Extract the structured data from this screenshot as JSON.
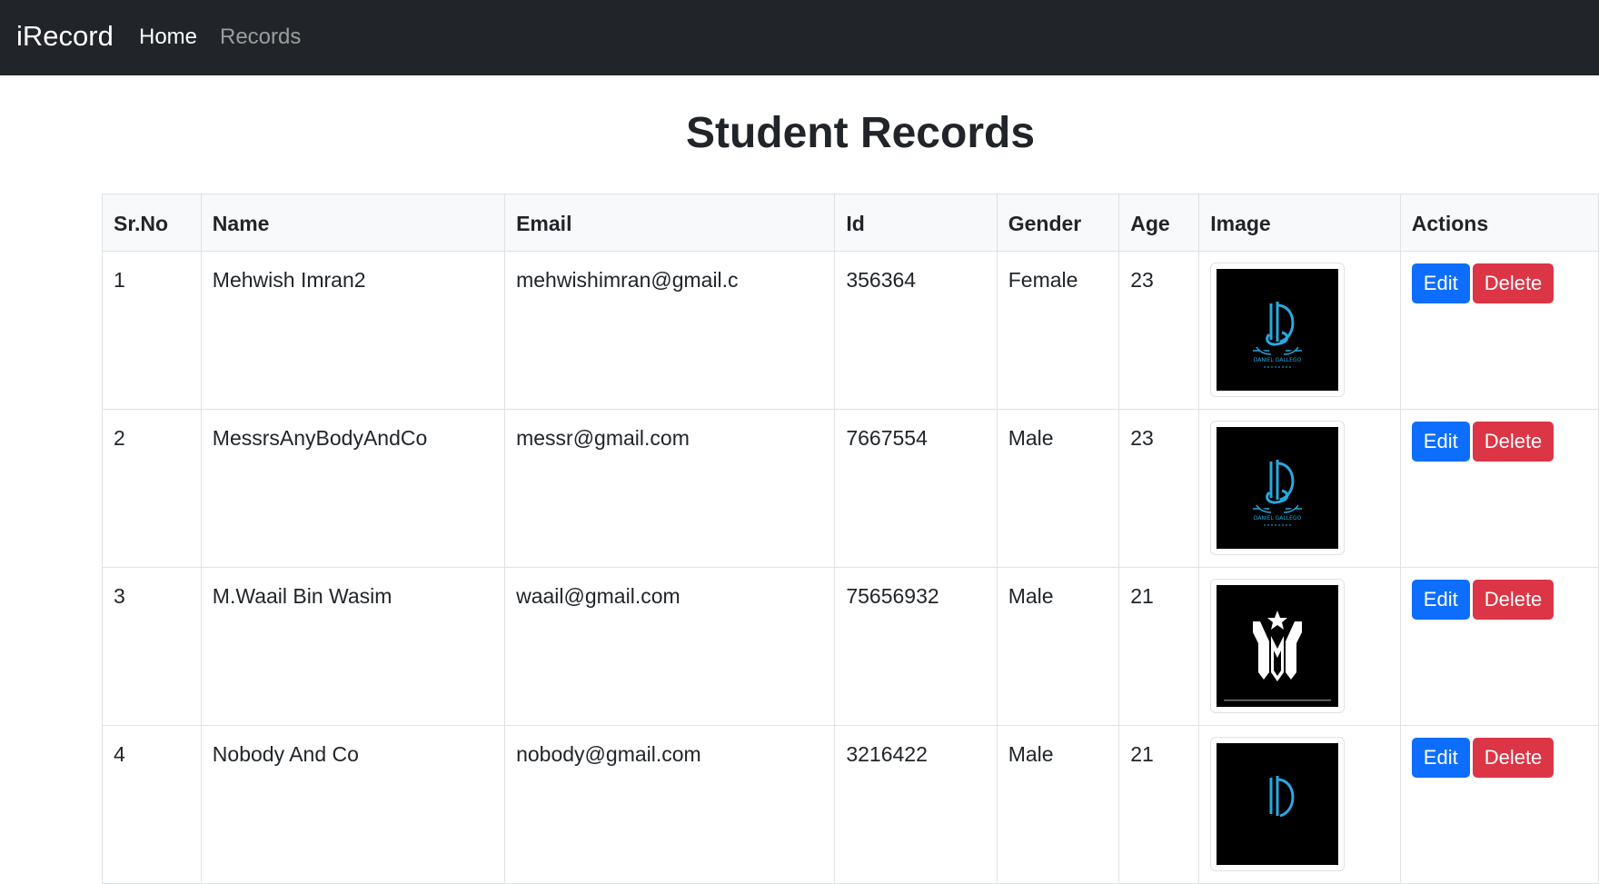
{
  "navbar": {
    "brand": "iRecord",
    "links": [
      {
        "label": "Home",
        "active": true
      },
      {
        "label": "Records",
        "active": false
      }
    ]
  },
  "page": {
    "title": "Student Records"
  },
  "table": {
    "headers": [
      "Sr.No",
      "Name",
      "Email",
      "Id",
      "Gender",
      "Age",
      "Image",
      "Actions"
    ],
    "rows": [
      {
        "srno": "1",
        "name": "Mehwish Imran2",
        "email": "mehwishimran@gmail.c",
        "id": "356364",
        "gender": "Female",
        "age": "23",
        "image": "DG-logo"
      },
      {
        "srno": "2",
        "name": "MessrsAnyBodyAndCo",
        "email": "messr@gmail.com",
        "id": "7667554",
        "gender": "Male",
        "age": "23",
        "image": "DG-logo"
      },
      {
        "srno": "3",
        "name": "M.Waail Bin Wasim",
        "email": "waail@gmail.com",
        "id": "75656932",
        "gender": "Male",
        "age": "21",
        "image": "M-star-logo"
      },
      {
        "srno": "4",
        "name": "Nobody And Co",
        "email": "nobody@gmail.com",
        "id": "3216422",
        "gender": "Male",
        "age": "21",
        "image": "DG-logo"
      }
    ],
    "actions": {
      "edit_label": "Edit",
      "delete_label": "Delete"
    }
  },
  "images": {
    "dg_caption": "DANIEL GALLEGO"
  },
  "colors": {
    "navbar_bg": "#212529",
    "edit_button": "#0d6efd",
    "delete_button": "#dc3545",
    "logo_blue": "#29a8e0"
  }
}
